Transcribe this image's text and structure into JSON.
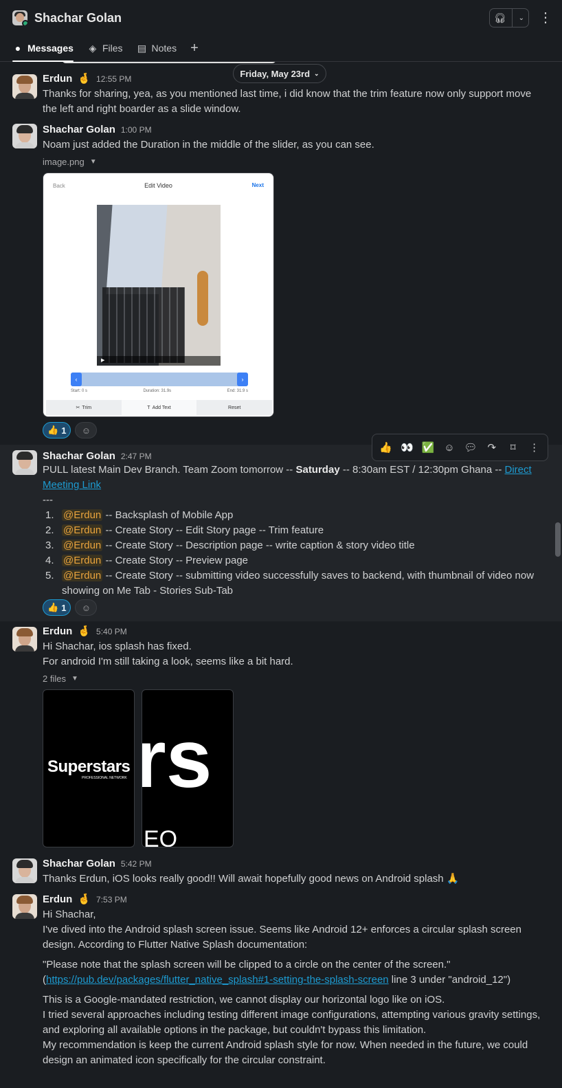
{
  "header": {
    "title": "Shachar Golan",
    "tabs": [
      {
        "label": "Messages",
        "icon": "message-bubble-icon"
      },
      {
        "label": "Files",
        "icon": "layers-icon"
      },
      {
        "label": "Notes",
        "icon": "note-icon"
      }
    ]
  },
  "date_divider": "Friday, May 23rd",
  "messages": [
    {
      "author": "Erdun",
      "badge": "🤞",
      "time": "12:55 PM",
      "text": "Thanks for sharing, yea, as you mentioned last time, i did know that the trim feature now only support move the left and right boarder as a slide window."
    },
    {
      "author": "Shachar Golan",
      "time": "1:00 PM",
      "text": "Noam just added the Duration in the middle of the slider, as you can see.",
      "file_label": "image.png",
      "image": {
        "back": "Back",
        "title": "Edit Video",
        "next": "Next",
        "start": "Start: 0 s",
        "duration": "Duration: 31.9s",
        "end": "End: 31.9 s",
        "trim": "Trim",
        "add_text": "Add Text",
        "reset": "Reset"
      },
      "reaction": {
        "emoji": "👍",
        "count": "1"
      }
    },
    {
      "author": "Shachar Golan",
      "time": "2:47 PM",
      "text_pre": "PULL latest Main Dev Branch. Team Zoom tomorrow --",
      "text_bold": "Saturday",
      "text_post": "-- 8:30am EST / 12:30pm Ghana --",
      "link": "Direct Meeting Link",
      "separator": "---",
      "items": [
        {
          "num": "1.",
          "mention": "@Erdun",
          "text": "-- Backsplash of Mobile App"
        },
        {
          "num": "2.",
          "mention": "@Erdun",
          "text": "-- Create Story -- Edit Story page -- Trim feature"
        },
        {
          "num": "3.",
          "mention": "@Erdun",
          "text": "-- Create Story -- Description page -- write caption & story video title"
        },
        {
          "num": "4.",
          "mention": "@Erdun",
          "text": "-- Create Story -- Preview page"
        },
        {
          "num": "5.",
          "mention": "@Erdun",
          "text": "-- Create Story -- submitting video successfully saves to backend, with thumbnail of video now showing on Me Tab - Stories Sub-Tab"
        }
      ],
      "reaction": {
        "emoji": "👍",
        "count": "1"
      }
    },
    {
      "author": "Erdun",
      "badge": "🤞",
      "time": "5:40 PM",
      "line1": "Hi Shachar, ios splash has fixed.",
      "line2": "For android I'm still taking a look, seems like a bit hard.",
      "file_label": "2 files",
      "thumb1_big": "Superstars",
      "thumb1_small": "PROFESSIONAL NETWORK",
      "thumb2_big": "rs",
      "thumb2_small": "EO PRC"
    },
    {
      "author": "Shachar Golan",
      "time": "5:42 PM",
      "text": "Thanks Erdun, iOS looks really good!! Will await hopefully good news on Android splash 🙏"
    },
    {
      "author": "Erdun",
      "badge": "🤞",
      "time": "7:53 PM",
      "p1": "Hi Shachar,",
      "p2": "I've dived into the Android splash screen issue. Seems like Android 12+ enforces a circular splash screen design. According to Flutter Native Splash documentation:",
      "quote1": "\"Please note that the splash screen will be clipped to a circle on the center of the screen.\"",
      "quote2_pre": "(",
      "quote2_link": "https://pub.dev/packages/flutter_native_splash#1-setting-the-splash-screen",
      "quote2_post": " line 3 under \"android_12\")",
      "p3": "This is a Google-mandated restriction, we cannot display our horizontal logo like on iOS.",
      "p4": "I tried several approaches including testing different image configurations, attempting various gravity settings, and exploring all available options in the package, but couldn't bypass this limitation.",
      "p5": "My recommendation is keep the current Android splash style for now. When needed in the future, we could design an animated icon specifically for the circular constraint."
    }
  ],
  "toolbar": [
    "👍",
    "👀",
    "✅",
    "add-reaction-icon",
    "reply-thread-icon",
    "forward-icon",
    "bookmark-icon",
    "more-icon"
  ]
}
